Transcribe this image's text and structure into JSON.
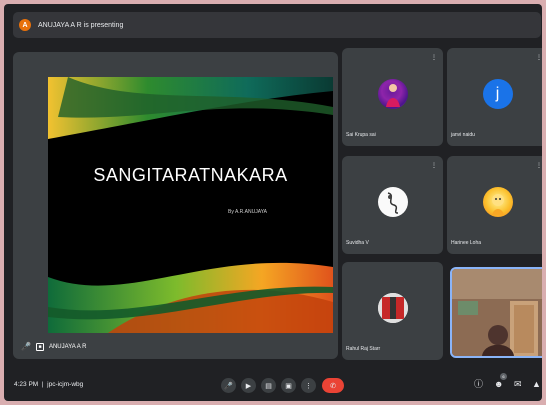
{
  "banner": {
    "initial": "A",
    "text": "ANUJAYA A R is presenting"
  },
  "slide": {
    "title": "SANGITARATNAKARA",
    "subtitle": "By A.R.ANUJAYA"
  },
  "presenter": {
    "name": "ANUJAYA A R"
  },
  "participants": [
    {
      "name": "Sai Krupa sai",
      "avatar": "purple-photo-avatar"
    },
    {
      "name": "janvi naidu",
      "initial": "j",
      "avatar": "letter-avatar"
    },
    {
      "name": "Suvidha V",
      "avatar": "sketch-avatar"
    },
    {
      "name": "Harinee Loha",
      "avatar": "yellow-cartoon-avatar"
    },
    {
      "name": "Rahul Raj Starr",
      "avatar": "flag-avatar"
    }
  ],
  "meeting": {
    "time": "4:23 PM",
    "code": "jpc-icjm-wbg"
  },
  "badge_count": "6",
  "colors": {
    "accent": "#8ab4f8",
    "end_call": "#ea4335",
    "banner_dot": "#e8710a",
    "tile_bg": "#3c4043"
  }
}
